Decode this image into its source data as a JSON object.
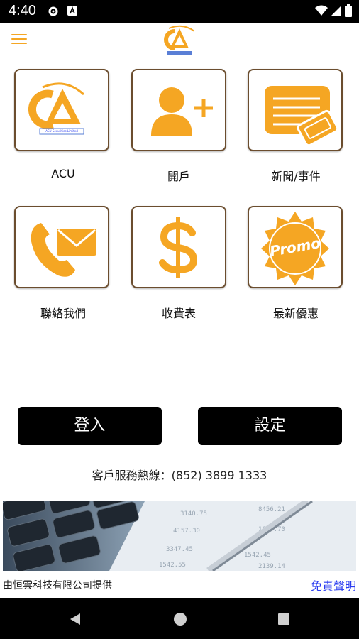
{
  "status_bar": {
    "time": "4:40"
  },
  "app_bar": {
    "logo_alt": "ACU Securities Limited"
  },
  "tiles": [
    {
      "label": "ACU"
    },
    {
      "label": "開戶"
    },
    {
      "label": "新聞/事件"
    },
    {
      "label": "聯絡我們"
    },
    {
      "label": "收費表"
    },
    {
      "label": "最新優惠"
    }
  ],
  "tile_logo_caption": "ACU Securities Limited",
  "promo_text": "Promo",
  "buttons": {
    "login": "登入",
    "settings": "設定"
  },
  "hotline": "客戶服務熱線：(852) 3899 1333",
  "footer": {
    "provider": "由恒雲科技有限公司提供",
    "disclaimer": "免責聲明"
  },
  "colors": {
    "accent": "#f5a623",
    "tile_border": "#6b4d2e",
    "link": "#2a3cf0"
  }
}
